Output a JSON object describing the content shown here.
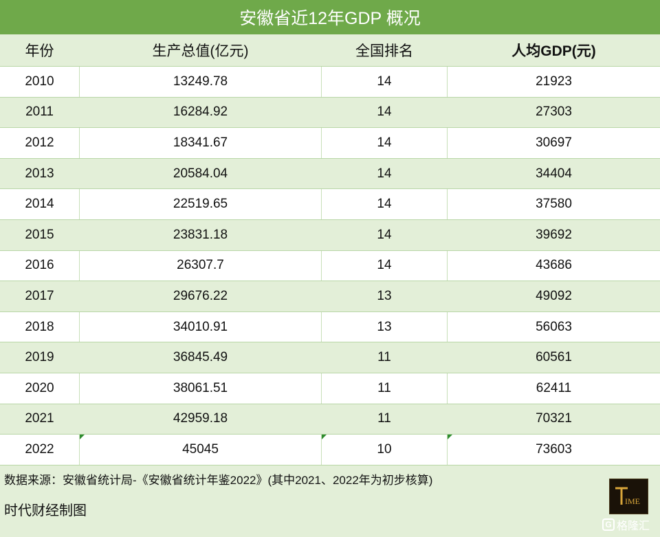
{
  "title": "安徽省近12年GDP 概况",
  "headers": [
    "年份",
    "生产总值(亿元)",
    "全国排名",
    "人均GDP(元)"
  ],
  "rows": [
    [
      "2010",
      "13249.78",
      "14",
      "21923"
    ],
    [
      "2011",
      "16284.92",
      "14",
      "27303"
    ],
    [
      "2012",
      "18341.67",
      "14",
      "30697"
    ],
    [
      "2013",
      "20584.04",
      "14",
      "34404"
    ],
    [
      "2014",
      "22519.65",
      "14",
      "37580"
    ],
    [
      "2015",
      "23831.18",
      "14",
      "39692"
    ],
    [
      "2016",
      "26307.7",
      "14",
      "43686"
    ],
    [
      "2017",
      "29676.22",
      "13",
      "49092"
    ],
    [
      "2018",
      "34010.91",
      "13",
      "56063"
    ],
    [
      "2019",
      "36845.49",
      "11",
      "60561"
    ],
    [
      "2020",
      "38061.51",
      "11",
      "62411"
    ],
    [
      "2021",
      "42959.18",
      "11",
      "70321"
    ],
    [
      "2022",
      "45045",
      "10",
      "73603"
    ]
  ],
  "source_note": "数据来源：安徽省统计局-《安徽省统计年鉴2022》(其中2021、2022年为初步核算)",
  "credit": "时代财经制图",
  "logo_text": "TIME",
  "watermark_text": "格隆汇",
  "colors": {
    "accent": "#6fa94a",
    "band": "#e3efd8",
    "marker": "#2e8b2e"
  }
}
